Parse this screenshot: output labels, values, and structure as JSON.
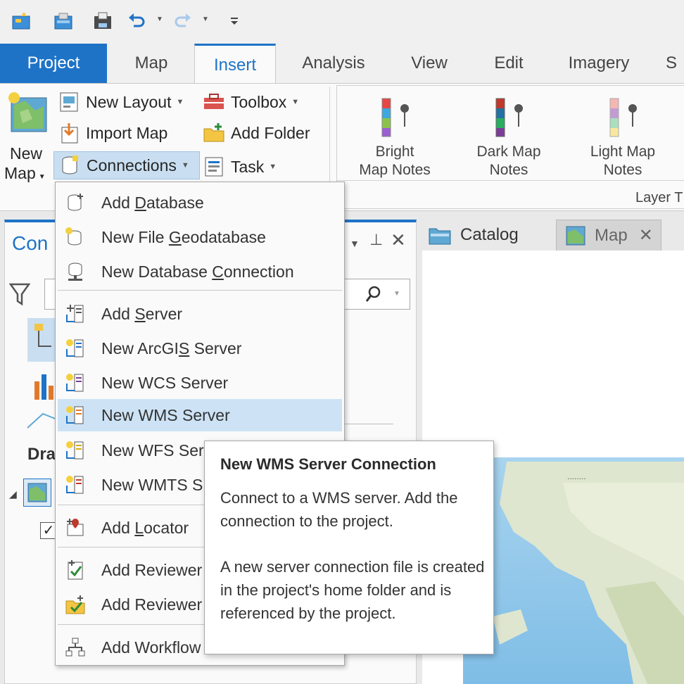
{
  "quick_access": {
    "icons": [
      "new-project-icon",
      "open-project-icon",
      "save-project-icon",
      "undo-icon",
      "redo-icon",
      "customize-icon"
    ]
  },
  "tabs": [
    {
      "label": "Project"
    },
    {
      "label": "Map"
    },
    {
      "label": "Insert"
    },
    {
      "label": "Analysis"
    },
    {
      "label": "View"
    },
    {
      "label": "Edit"
    },
    {
      "label": "Imagery"
    },
    {
      "label": "S"
    }
  ],
  "ribbon": {
    "new_map_line1": "New",
    "new_map_line2": "Map",
    "new_layout": "New Layout",
    "import_map": "Import Map",
    "connections": "Connections",
    "toolbox": "Toolbox",
    "add_folder": "Add Folder",
    "task": "Task",
    "bright_notes_1": "Bright",
    "bright_notes_2": "Map Notes",
    "dark_notes_1": "Dark Map",
    "dark_notes_2": "Notes",
    "light_notes_1": "Light Map",
    "light_notes_2": "Notes",
    "layer_group_label": "Layer T"
  },
  "contents_pane": {
    "title": "Con",
    "drawing_order": "Dra"
  },
  "map_view": {
    "catalog_tab": "Catalog",
    "map_tab": "Map",
    "scale_text": "........"
  },
  "menu": {
    "items": [
      {
        "pre": "Add ",
        "u": "D",
        "post": "atabase"
      },
      {
        "pre": "New File ",
        "u": "G",
        "post": "eodatabase"
      },
      {
        "pre": "New Database ",
        "u": "C",
        "post": "onnection"
      },
      {
        "pre": "Add ",
        "u": "S",
        "post": "erver"
      },
      {
        "pre": "New ArcGI",
        "u": "S",
        "post": " Server"
      },
      {
        "pre": "New WCS Server",
        "u": "",
        "post": ""
      },
      {
        "pre": "New WMS Server",
        "u": "",
        "post": ""
      },
      {
        "pre": "New WFS Ser",
        "u": "",
        "post": ""
      },
      {
        "pre": "New WMTS S",
        "u": "",
        "post": ""
      },
      {
        "pre": "Add ",
        "u": "L",
        "post": "ocator"
      },
      {
        "pre": "Add Reviewer",
        "u": "",
        "post": ""
      },
      {
        "pre": "Add Reviewer",
        "u": "",
        "post": ""
      },
      {
        "pre": "Add Workflow",
        "u": "",
        "post": ""
      }
    ]
  },
  "tooltip": {
    "title": "New WMS Server Connection",
    "p1": "Connect to a WMS server. Add the connection to the project.",
    "p2": "A new server connection file is created in the project's home folder and is referenced by the project."
  },
  "colors": {
    "accent": "#1e73c7",
    "highlight": "#cde3f5"
  }
}
